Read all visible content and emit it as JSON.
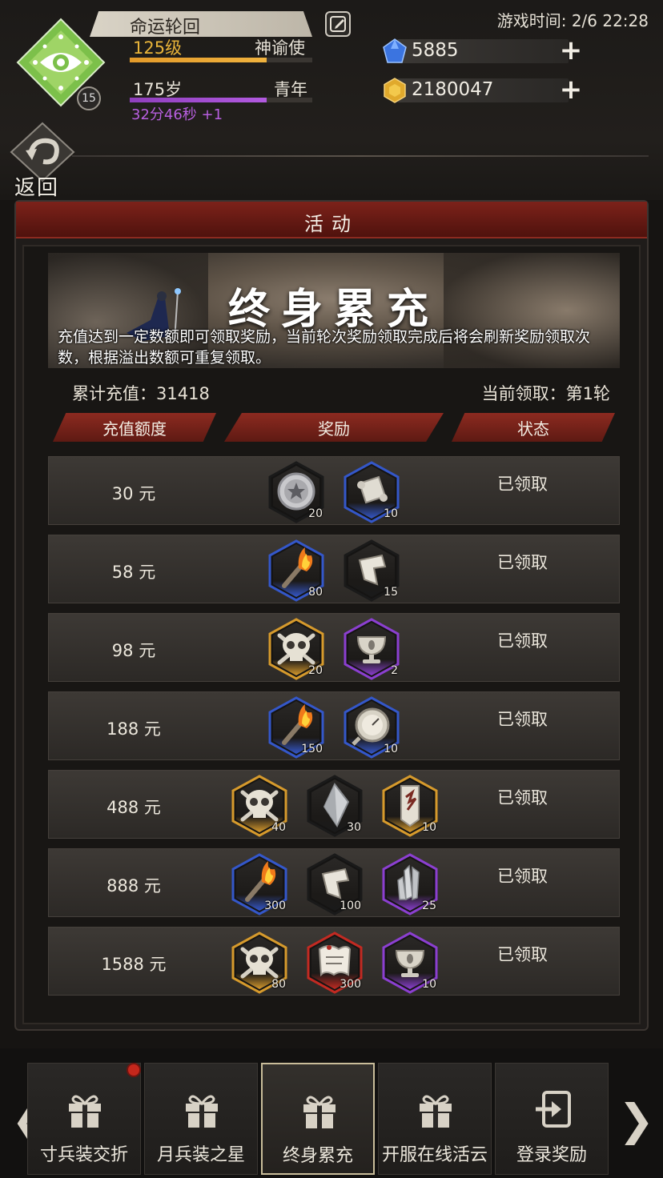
{
  "player": {
    "name": "命运轮回",
    "level": "125级",
    "title": "神谕使",
    "level_progress": 0.75,
    "age": "175岁",
    "life_stage": "青年",
    "age_progress": 0.75,
    "timer": "32分46秒 +1",
    "badge_level": "15"
  },
  "game_time": "游戏时间: 2/6 22:28",
  "currency": {
    "gems": "5885",
    "gold": "2180047"
  },
  "back_label": "返回",
  "panel_title": "活动",
  "banner": {
    "title": "终身累充",
    "description": "充值达到一定数额即可领取奖励，当前轮次奖励领取完成后将会刷新奖励领取次数，根据溢出数额可重复领取。"
  },
  "stats": {
    "total": "累计充值：31418",
    "round": "当前领取：第1轮"
  },
  "columns": [
    "充值额度",
    "奖励",
    "状态"
  ],
  "rows": [
    {
      "amount": "30 元",
      "status": "已领取",
      "items": [
        {
          "icon": "silver-coin-icon",
          "count": "20",
          "frame": "#1a1a1a"
        },
        {
          "icon": "scroll-icon",
          "count": "10",
          "frame": "#3457c9"
        }
      ]
    },
    {
      "amount": "58 元",
      "status": "已领取",
      "items": [
        {
          "icon": "torch-icon",
          "count": "80",
          "frame": "#3457c9"
        },
        {
          "icon": "fragment-icon",
          "count": "15",
          "frame": "#1a1a1a"
        }
      ]
    },
    {
      "amount": "98 元",
      "status": "已领取",
      "items": [
        {
          "icon": "skull-icon",
          "count": "20",
          "frame": "#d69a2c"
        },
        {
          "icon": "chalice-icon",
          "count": "2",
          "frame": "#8b3fd0"
        }
      ]
    },
    {
      "amount": "188 元",
      "status": "已领取",
      "items": [
        {
          "icon": "torch-icon",
          "count": "150",
          "frame": "#3457c9"
        },
        {
          "icon": "compass-icon",
          "count": "10",
          "frame": "#3457c9"
        }
      ]
    },
    {
      "amount": "488 元",
      "status": "已领取",
      "items": [
        {
          "icon": "skull-icon",
          "count": "40",
          "frame": "#d69a2c"
        },
        {
          "icon": "crystal-icon",
          "count": "30",
          "frame": "#1a1a1a"
        },
        {
          "icon": "banner-card-icon",
          "count": "10",
          "frame": "#d69a2c"
        }
      ]
    },
    {
      "amount": "888 元",
      "status": "已领取",
      "items": [
        {
          "icon": "torch-icon",
          "count": "300",
          "frame": "#3457c9"
        },
        {
          "icon": "fragment-icon",
          "count": "100",
          "frame": "#1a1a1a"
        },
        {
          "icon": "crystals-icon",
          "count": "25",
          "frame": "#8b3fd0"
        }
      ]
    },
    {
      "amount": "1588 元",
      "status": "已领取",
      "items": [
        {
          "icon": "skull-icon",
          "count": "80",
          "frame": "#d69a2c"
        },
        {
          "icon": "parchment-icon",
          "count": "300",
          "frame": "#c22a22"
        },
        {
          "icon": "chalice-icon",
          "count": "10",
          "frame": "#8b3fd0"
        }
      ]
    }
  ],
  "tabs": [
    {
      "label": "寸兵装交折",
      "icon": "gift-icon",
      "active": false,
      "badge": true
    },
    {
      "label": "月兵装之星",
      "icon": "gift-icon",
      "active": false,
      "badge": false
    },
    {
      "label": "终身累充",
      "icon": "gift-icon",
      "active": true,
      "badge": false
    },
    {
      "label": "开服在线活云",
      "icon": "gift-icon",
      "active": false,
      "badge": false
    },
    {
      "label": "登录奖励",
      "icon": "login-icon",
      "active": false,
      "badge": false
    }
  ],
  "colors": {
    "accent_red": "#7d221a",
    "level_orange": "#f0b23e",
    "age_purple": "#b25ae0",
    "emblem_green": "#7cc04a"
  }
}
